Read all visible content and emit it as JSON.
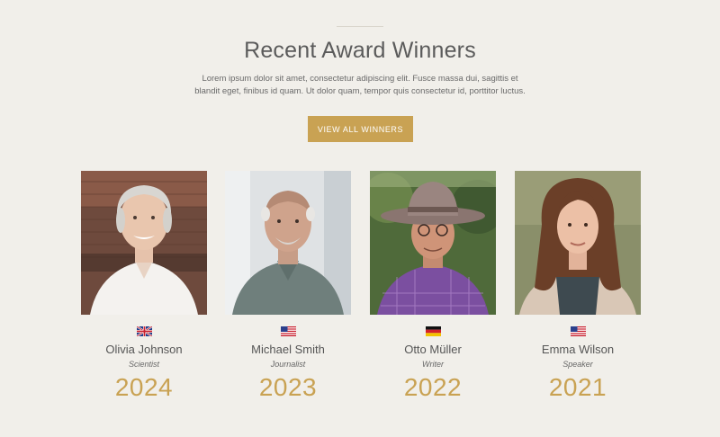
{
  "section": {
    "title": "Recent Award Winners",
    "intro_line1": "Lorem ipsum dolor sit amet, consectetur adipiscing elit. Fusce massa dui, sagittis et",
    "intro_line2": "blandit eget, finibus id quam. Ut dolor quam, tempor quis consectetur id, porttitor luctus.",
    "cta_label": "VIEW ALL WINNERS"
  },
  "winners": [
    {
      "name": "Olivia Johnson",
      "role": "Scientist",
      "year": "2024",
      "flag_icon": "uk-flag-icon"
    },
    {
      "name": "Michael Smith",
      "role": "Journalist",
      "year": "2023",
      "flag_icon": "us-flag-icon"
    },
    {
      "name": "Otto Müller",
      "role": "Writer",
      "year": "2022",
      "flag_icon": "germany-flag-icon"
    },
    {
      "name": "Emma Wilson",
      "role": "Speaker",
      "year": "2021",
      "flag_icon": "us-flag-icon"
    }
  ],
  "colors": {
    "background": "#f1efea",
    "accent": "#c9a253",
    "text": "#555555"
  }
}
